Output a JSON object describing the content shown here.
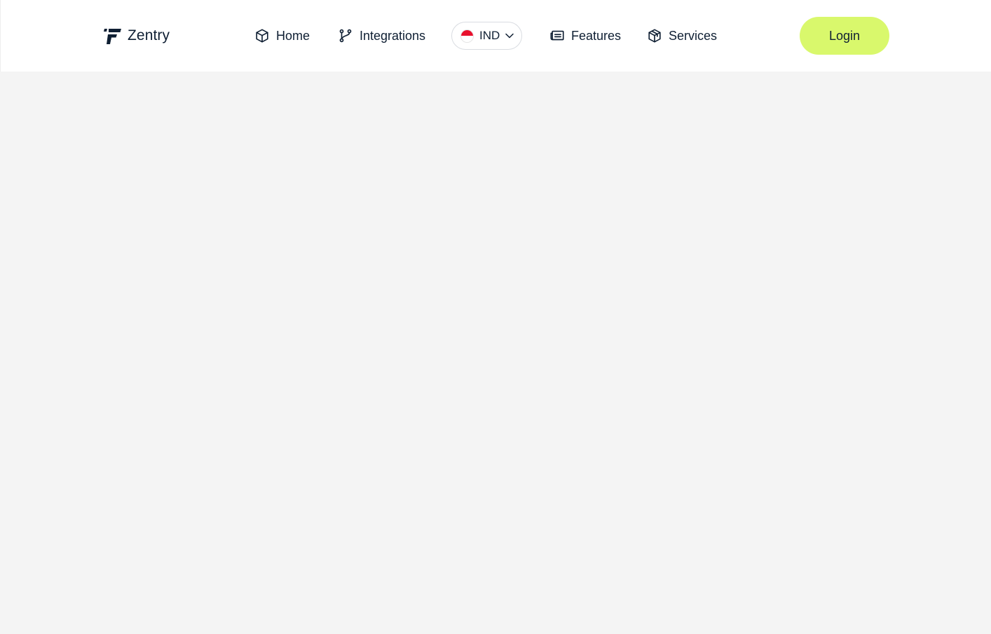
{
  "brand": {
    "name": "Zentry",
    "logo_icon": "zentry-logo-icon"
  },
  "nav": {
    "items": [
      {
        "label": "Home",
        "icon": "cube-icon"
      },
      {
        "label": "Integrations",
        "icon": "git-branch-icon"
      },
      {
        "label": "Features",
        "icon": "newspaper-icon"
      },
      {
        "label": "Services",
        "icon": "package-icon"
      }
    ]
  },
  "language": {
    "selected": "IND",
    "flag": "indonesia-flag-icon",
    "flag_colors": {
      "top": "#e8112d",
      "bottom": "#ffffff"
    }
  },
  "login": {
    "label": "Login"
  },
  "colors": {
    "accent": "#d9f86c",
    "text": "#0f1f33",
    "page_background": "#f4f4f4",
    "header_background": "#ffffff"
  }
}
